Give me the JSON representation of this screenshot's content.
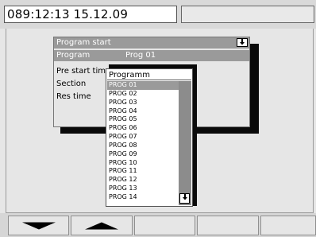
{
  "header": {
    "clock": "089:12:13  15.12.09"
  },
  "dialog": {
    "title": "Program start",
    "title_button_icon": "arrow-down-icon",
    "rows": [
      {
        "label": "Program",
        "value": "Prog 01"
      },
      {
        "label": "Pre start time"
      },
      {
        "label": "Section"
      },
      {
        "label": "Res time"
      }
    ]
  },
  "dropdown": {
    "header": "Programm",
    "items": [
      "PROG 01",
      "PROG 02",
      "PROG 03",
      "PROG 04",
      "PROG 05",
      "PROG 06",
      "PROG 07",
      "PROG 08",
      "PROG 09",
      "PROG 10",
      "PROG 11",
      "PROG 12",
      "PROG 13",
      "PROG 14"
    ],
    "selected_index": 0,
    "scroll_button_icon": "arrow-down-icon"
  },
  "softkeys": [
    {
      "icon": "triangle-down-icon"
    },
    {
      "icon": "triangle-up-icon"
    },
    {
      "icon": ""
    },
    {
      "icon": ""
    },
    {
      "icon": ""
    }
  ],
  "colors": {
    "highlight": "#9a9a9a",
    "shadow": "#0a0a0a",
    "background": "#e6e6e6"
  }
}
